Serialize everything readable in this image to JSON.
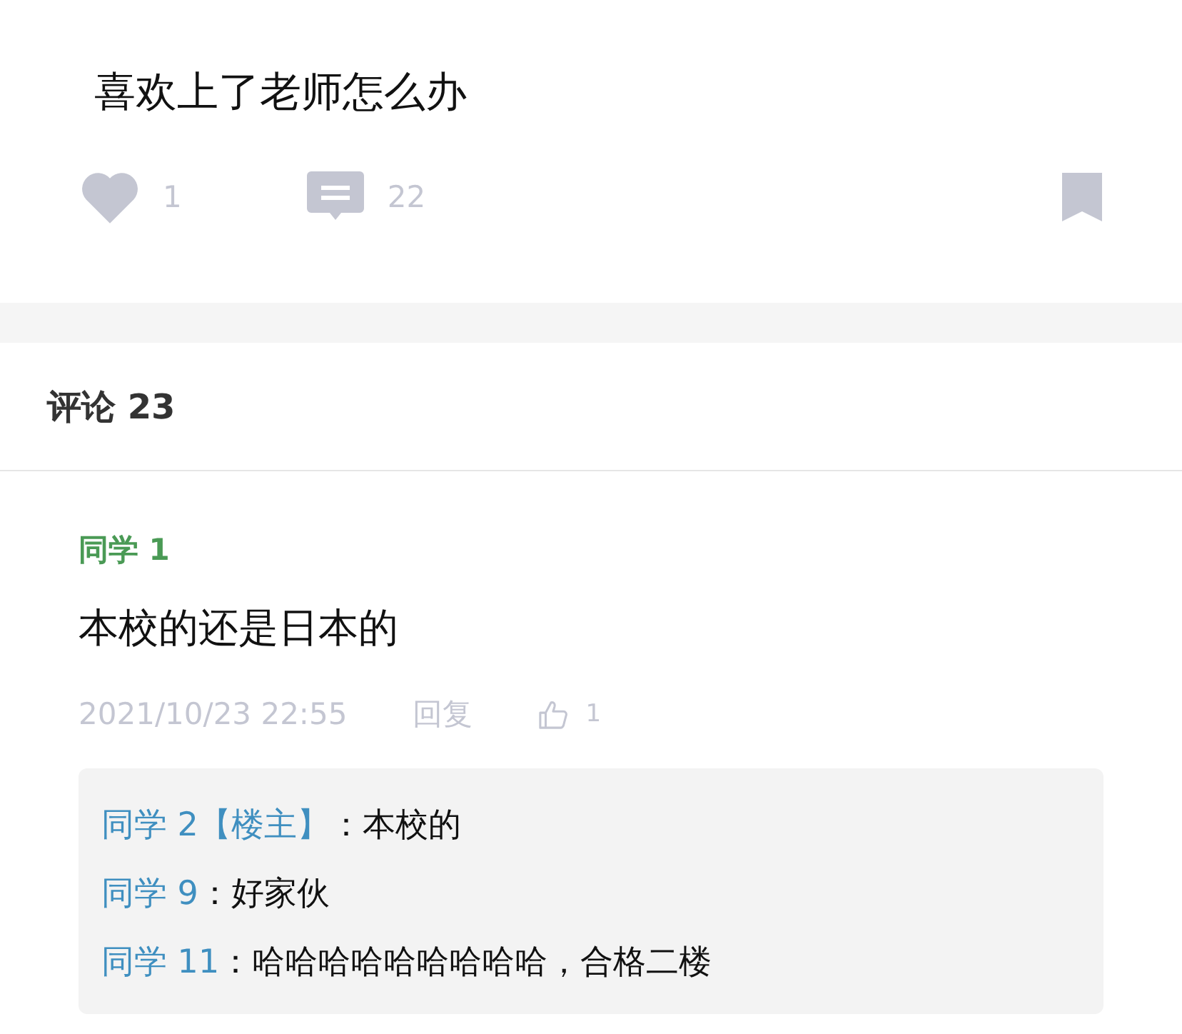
{
  "post": {
    "text": "喜欢上了老师怎么办",
    "likes": "1",
    "comments": "22"
  },
  "comments_header": {
    "label": "评论",
    "count": "23"
  },
  "comments": [
    {
      "author": "同学 1",
      "text": "本校的还是日本的",
      "time": "2021/10/23 22:55",
      "reply": "回复",
      "likes": "1",
      "replies": [
        {
          "author": "同学 2【楼主】",
          "separator": "：",
          "text": "本校的"
        },
        {
          "author": "同学 9",
          "separator": "：",
          "text": "好家伙"
        },
        {
          "author": "同学 11",
          "separator": "：",
          "text": "哈哈哈哈哈哈哈哈哈，合格二楼"
        }
      ]
    }
  ]
}
